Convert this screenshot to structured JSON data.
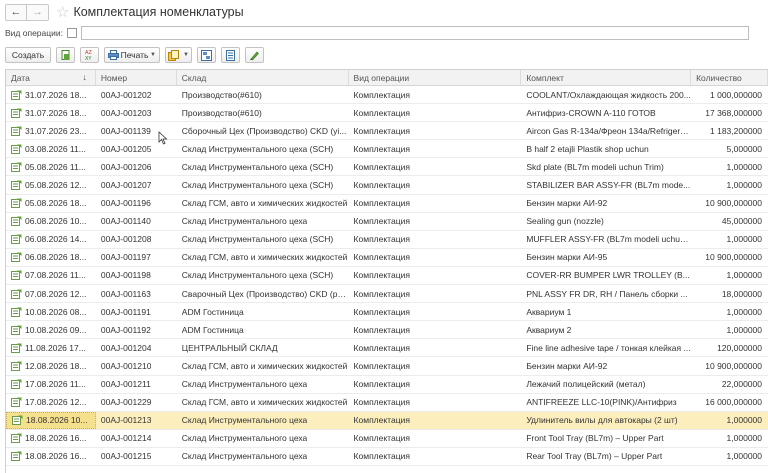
{
  "window": {
    "title": "Комплектация номенклатуры",
    "back_icon": "←",
    "forward_icon": "→",
    "favorite_icon": "☆"
  },
  "filter": {
    "label": "Вид операции:",
    "checked": false,
    "value": ""
  },
  "toolbar": {
    "create_label": "Создать",
    "print_label": "Печать"
  },
  "table": {
    "columns": [
      "Дата",
      "Номер",
      "Склад",
      "Вид операции",
      "Комплект",
      "Количество"
    ],
    "sort_column": "Дата",
    "selected_row": 18,
    "rows": [
      {
        "date": "31.07.2026 18...",
        "number": "00AJ-001202",
        "warehouse": "Производство(#610)",
        "operation": "Комплектация",
        "kit": "COOLANT/Охлаждающая жидкость 200...",
        "qty": "1 000,000000"
      },
      {
        "date": "31.07.2026 18...",
        "number": "00AJ-001203",
        "warehouse": "Производство(#610)",
        "operation": "Комплектация",
        "kit": "Антифриз-CROWN A-110 ГОТОВ",
        "qty": "17 368,000000"
      },
      {
        "date": "31.07.2026 23...",
        "number": "00AJ-001139",
        "warehouse": "Сборочный Цех (Производство) CKD (yi...",
        "operation": "Комплектация",
        "kit": "Aircon Gas R-134a/Фреон 134a/Refrigera...",
        "qty": "1 183,200000"
      },
      {
        "date": "03.08.2026 11...",
        "number": "00AJ-001205",
        "warehouse": "Склад Инструментального цеха (SCH)",
        "operation": "Комплектация",
        "kit": "B half 2 etajli Plastik shop uchun",
        "qty": "5,000000"
      },
      {
        "date": "05.08.2026 11...",
        "number": "00AJ-001206",
        "warehouse": "Склад Инструментального цеха (SCH)",
        "operation": "Комплектация",
        "kit": "Skd plate (BL7m modeli uchun Trim)",
        "qty": "1,000000"
      },
      {
        "date": "05.08.2026 12...",
        "number": "00AJ-001207",
        "warehouse": "Склад Инструментального цеха (SCH)",
        "operation": "Комплектация",
        "kit": "STABILIZER BAR ASSY-FR (BL7m mode...",
        "qty": "1,000000"
      },
      {
        "date": "05.08.2026 18...",
        "number": "00AJ-001196",
        "warehouse": "Склад ГСМ, авто и химических жидкостей",
        "operation": "Комплектация",
        "kit": "Бензин марки АИ-92",
        "qty": "10 900,000000"
      },
      {
        "date": "06.08.2026 10...",
        "number": "00AJ-001140",
        "warehouse": "Склад Инструментального цеха",
        "operation": "Комплектация",
        "kit": "Sealing gun (nozzle)",
        "qty": "45,000000"
      },
      {
        "date": "06.08.2026 14...",
        "number": "00AJ-001208",
        "warehouse": "Склад Инструментального цеха (SCH)",
        "operation": "Комплектация",
        "kit": "MUFFLER ASSY-FR (BL7m modeli uchun...",
        "qty": "1,000000"
      },
      {
        "date": "06.08.2026 18...",
        "number": "00AJ-001197",
        "warehouse": "Склад ГСМ, авто и химических жидкостей",
        "operation": "Комплектация",
        "kit": "Бензин марки АИ-95",
        "qty": "10 900,000000"
      },
      {
        "date": "07.08.2026 11...",
        "number": "00AJ-001198",
        "warehouse": "Склад Инструментального цеха (SCH)",
        "operation": "Комплектация",
        "kit": "COVER-RR BUMPER LWR TROLLEY (B...",
        "qty": "1,000000"
      },
      {
        "date": "07.08.2026 12...",
        "number": "00AJ-001163",
        "warehouse": "Сварочный Цех (Производство) CKD (ре...",
        "operation": "Комплектация",
        "kit": "PNL ASSY FR DR, RH / Панель сборки ...",
        "qty": "18,000000"
      },
      {
        "date": "10.08.2026 08...",
        "number": "00AJ-001191",
        "warehouse": "ADM Гостиница",
        "operation": "Комплектация",
        "kit": "Аквариум 1",
        "qty": "1,000000"
      },
      {
        "date": "10.08.2026 09...",
        "number": "00AJ-001192",
        "warehouse": "ADM Гостиница",
        "operation": "Комплектация",
        "kit": "Аквариум 2",
        "qty": "1,000000"
      },
      {
        "date": "11.08.2026 17...",
        "number": "00AJ-001204",
        "warehouse": "ЦЕНТРАЛЬНЫЙ СКЛАД",
        "operation": "Комплектация",
        "kit": "Fine line adhesive tape / тонкая клейкая ...",
        "qty": "120,000000"
      },
      {
        "date": "12.08.2026 18...",
        "number": "00AJ-001210",
        "warehouse": "Склад ГСМ, авто и химических жидкостей",
        "operation": "Комплектация",
        "kit": "Бензин марки АИ-92",
        "qty": "10 900,000000"
      },
      {
        "date": "17.08.2026 11...",
        "number": "00AJ-001211",
        "warehouse": "Склад Инструментального цеха",
        "operation": "Комплектация",
        "kit": "Лежачий полицейский (метал)",
        "qty": "22,000000"
      },
      {
        "date": "17.08.2026 12...",
        "number": "00AJ-001229",
        "warehouse": "Склад ГСМ, авто и химических жидкостей",
        "operation": "Комплектация",
        "kit": "ANTIFREEZE LLC-10(PINK)/Антифриз",
        "qty": "16 000,000000"
      },
      {
        "date": "18.08.2026 10...",
        "number": "00AJ-001213",
        "warehouse": "Склад Инструментального цеха",
        "operation": "Комплектация",
        "kit": "Удлинитель вилы для автокары (2 шт)",
        "qty": "1,000000"
      },
      {
        "date": "18.08.2026 16...",
        "number": "00AJ-001214",
        "warehouse": "Склад Инструментального цеха",
        "operation": "Комплектация",
        "kit": "Front Tool Tray (BL7m) – Upper Part",
        "qty": "1,000000"
      },
      {
        "date": "18.08.2026 16...",
        "number": "00AJ-001215",
        "warehouse": "Склад Инструментального цеха",
        "operation": "Комплектация",
        "kit": "Rear Tool Tray (BL7m) – Upper Part",
        "qty": "1,000000"
      }
    ]
  }
}
